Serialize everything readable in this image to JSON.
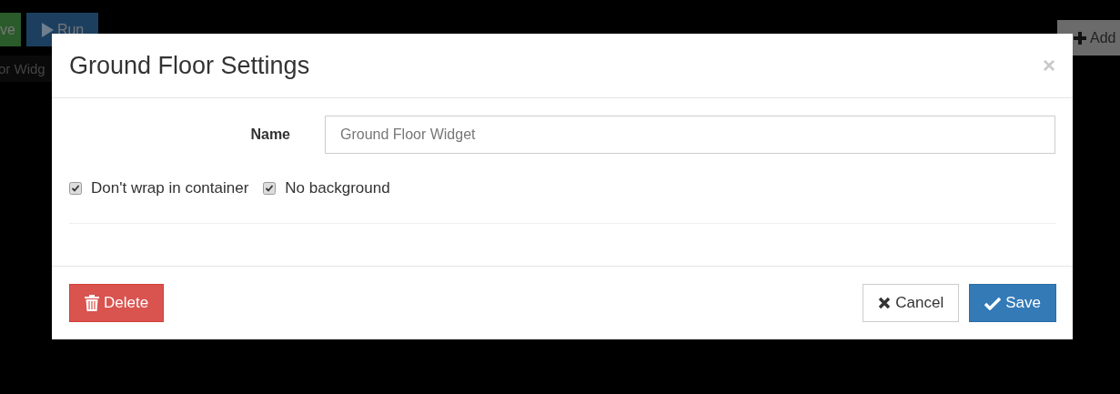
{
  "background": {
    "toolbar_buttons": [
      {
        "label": "ve",
        "kind": "success"
      },
      {
        "label": "Run",
        "kind": "primary"
      }
    ],
    "widget_tab": "or Widg",
    "add_button": "Add"
  },
  "modal": {
    "title": "Ground Floor Settings",
    "close": "×",
    "fields": [
      {
        "label": "Name",
        "value": "Ground Floor Widget"
      }
    ],
    "options": [
      {
        "label": "Don't wrap in container",
        "checked": true
      },
      {
        "label": "No background",
        "checked": true
      }
    ],
    "buttons": [
      {
        "label": "Delete",
        "kind": "danger"
      },
      {
        "label": "Cancel",
        "kind": "default"
      },
      {
        "label": "Save",
        "kind": "primary"
      }
    ]
  }
}
